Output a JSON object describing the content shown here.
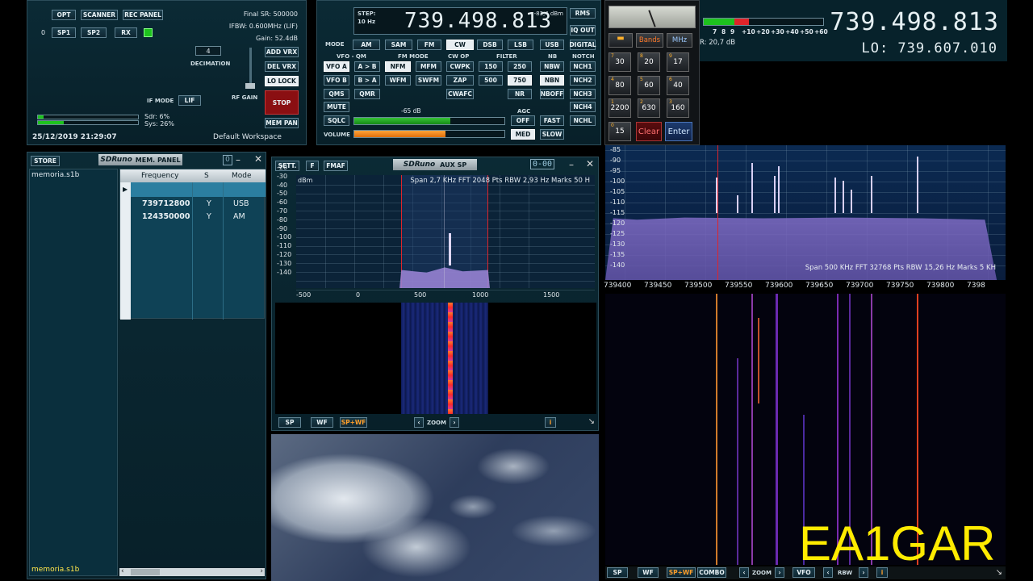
{
  "main_panel": {
    "buttons": {
      "opt": "OPT",
      "scanner": "SCANNER",
      "rec_panel": "REC PANEL",
      "sp1": "SP1",
      "sp2": "SP2",
      "rx": "RX",
      "add_vrx": "ADD VRX",
      "del_vrx": "DEL VRX",
      "lo_lock": "LO LOCK",
      "stop": "STOP",
      "mem_pan": "MEM PAN",
      "lif": "LIF"
    },
    "rx_index": "0",
    "final_sr": "Final SR: 500000",
    "ifbw": "IFBW: 0.600MHz (LIF)",
    "gain": "Gain: 52.4dB",
    "decimation_value": "4",
    "decimation_label": "DECIMATION",
    "rf_gain_label": "RF GAIN",
    "if_mode_label": "IF MODE",
    "sdr_load": "Sdr: 6%",
    "sys_load": "Sys: 26%",
    "sdr_load_pct": 6,
    "sys_load_pct": 26,
    "datetime": "25/12/2019 21:29:07",
    "workspace": "Default Workspace"
  },
  "rx_control": {
    "step_label": "STEP:",
    "step_value": "10 Hz",
    "frequency": "739.498.813",
    "signal_dbm": "-83,4 dBm",
    "rms": "RMS",
    "iq_out": "IQ OUT",
    "mode_label": "MODE",
    "modes": [
      "AM",
      "SAM",
      "FM",
      "CW",
      "DSB",
      "LSB",
      "USB",
      "DIGITAL"
    ],
    "active_mode": "CW",
    "vfo_qm_label": "VFO - QM",
    "fm_mode_label": "FM MODE",
    "cw_op_label": "CW OP",
    "filter_label": "FILTER",
    "nb_label": "NB",
    "notch_label": "NOTCH",
    "vfo_a": "VFO A",
    "a_to_b": "A > B",
    "nfm": "NFM",
    "mfm": "MFM",
    "cwpk": "CWPK",
    "f150": "150",
    "f250": "250",
    "nbw": "NBW",
    "nch1": "NCH1",
    "vfo_b": "VFO B",
    "b_to_a": "B > A",
    "wfm": "WFM",
    "swfm": "SWFM",
    "zap": "ZAP",
    "f500": "500",
    "f750": "750",
    "nbn": "NBN",
    "nch2": "NCH2",
    "qms": "QMS",
    "qmr": "QMR",
    "cwafc": "CWAFC",
    "nboff": "NBOFF",
    "nch3": "NCH3",
    "mute": "MUTE",
    "nr": "NR",
    "nch4": "NCH4",
    "sqlc": "SQLC",
    "sql_level": "-65 dB",
    "agc_label": "AGC",
    "off": "OFF",
    "fast": "FAST",
    "nchl": "NCHL",
    "volume": "VOLUME",
    "med": "MED",
    "slow": "SLOW"
  },
  "keypad": {
    "bands": "Bands",
    "mhz": "MHz",
    "keys": [
      {
        "num": "1",
        "val": "2200"
      },
      {
        "num": "2",
        "val": "630"
      },
      {
        "num": "3",
        "val": "160"
      },
      {
        "num": "4",
        "val": "80"
      },
      {
        "num": "5",
        "val": "60"
      },
      {
        "num": "6",
        "val": "40"
      },
      {
        "num": "7",
        "val": "30"
      },
      {
        "num": "8",
        "val": "20"
      },
      {
        "num": "9",
        "val": "17"
      }
    ],
    "zero": {
      "num": "0",
      "val": "15"
    },
    "clear": "Clear",
    "enter": "Enter"
  },
  "main_display": {
    "frequency": "739.498.813",
    "lo": "LO: 739.607.010",
    "smeter_scale": [
      "7",
      "8",
      "9",
      "+10",
      "+20",
      "+30",
      "+40",
      "+50",
      "+60"
    ],
    "readout": "R: 20,7 dB",
    "dbm_ticks": [
      "-85",
      "-90",
      "-95",
      "-100",
      "-105",
      "-110",
      "-115",
      "-120",
      "-125",
      "-130",
      "-135",
      "-140"
    ],
    "freq_ticks": [
      "739400",
      "739450",
      "739500",
      "739550",
      "739600",
      "739650",
      "739700",
      "739750",
      "739800",
      "7398"
    ],
    "info": "Span 500 KHz   FFT 32768 Pts   RBW 15,26 Hz   Marks 5 KH",
    "bottom_buttons": {
      "sp": "SP",
      "wf": "WF",
      "spwf": "SP+WF",
      "combo": "COMBO",
      "zoom": "ZOOM",
      "vfo": "VFO",
      "rbw": "RBW",
      "info": "i"
    }
  },
  "memory_panel": {
    "store": "STORE",
    "brand": "SDRuno",
    "title": "MEM. PANEL",
    "file_name": "memoria.s1b",
    "headers": [
      "Frequency",
      "S",
      "Mode"
    ],
    "rows": [
      {
        "freq": "739712800",
        "s": "Y",
        "mode": "USB"
      },
      {
        "freq": "124350000",
        "s": "Y",
        "mode": "AM"
      }
    ]
  },
  "aux_sp": {
    "sett": "SETT.",
    "f": "F",
    "fmaf": "FMAF",
    "brand": "SDRuno",
    "title": "AUX SP",
    "counter": "0-00",
    "unit": "dBm",
    "info": "Span 2,7 KHz   FFT 2048 Pts   RBW 2,93 Hz   Marks 50 H",
    "dbm_ticks": [
      "-20",
      "-30",
      "-40",
      "-50",
      "-60",
      "-70",
      "-80",
      "-90",
      "-100",
      "-110",
      "-120",
      "-130",
      "-140"
    ],
    "freq_ticks": [
      "-500",
      "0",
      "500",
      "1000",
      "1500"
    ],
    "bottom_buttons": {
      "sp": "SP",
      "wf": "WF",
      "spwf": "SP+WF",
      "zoom": "ZOOM",
      "info": "i"
    }
  },
  "watermark": "EA1GAR",
  "colors": {
    "accent_green": "#1ec21e",
    "accent_orange": "#ff8a1a",
    "marker_red": "#e0242a",
    "spectrum_fill": "#6b5aa8"
  }
}
